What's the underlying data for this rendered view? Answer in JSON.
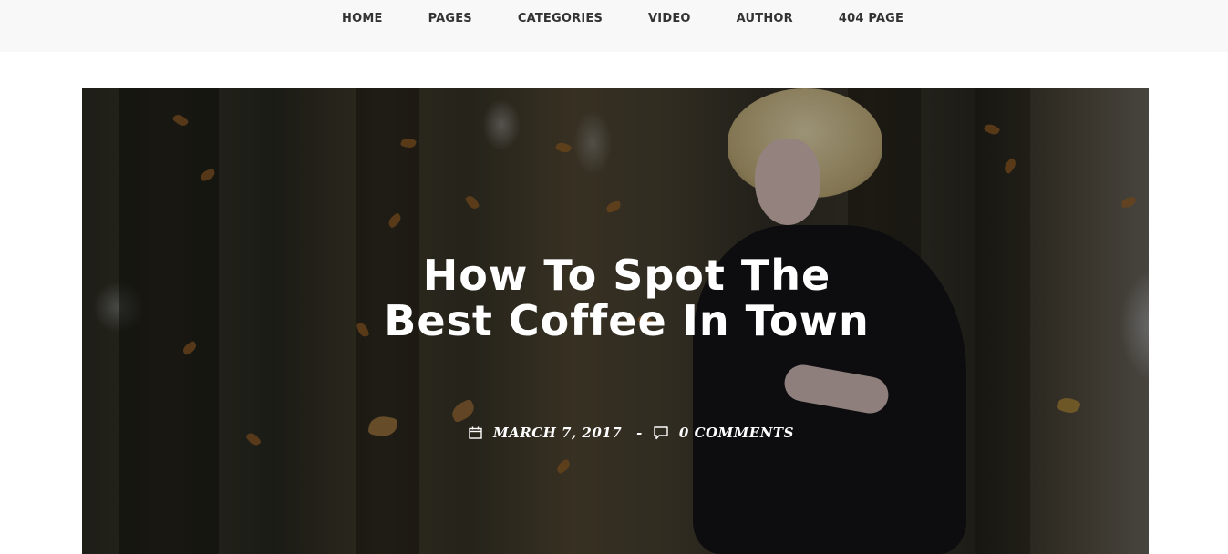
{
  "nav": {
    "items": [
      {
        "label": "HOME"
      },
      {
        "label": "PAGES"
      },
      {
        "label": "CATEGORIES"
      },
      {
        "label": "VIDEO"
      },
      {
        "label": "AUTHOR"
      },
      {
        "label": "404 PAGE"
      }
    ]
  },
  "hero": {
    "title_line1": "How To Spot The",
    "title_line2": "Best Coffee In Town",
    "date": "MARCH 7, 2017",
    "separator": "-",
    "comments": "0 COMMENTS",
    "icons": {
      "date": "calendar-icon",
      "comments": "comment-bubble-icon"
    }
  }
}
